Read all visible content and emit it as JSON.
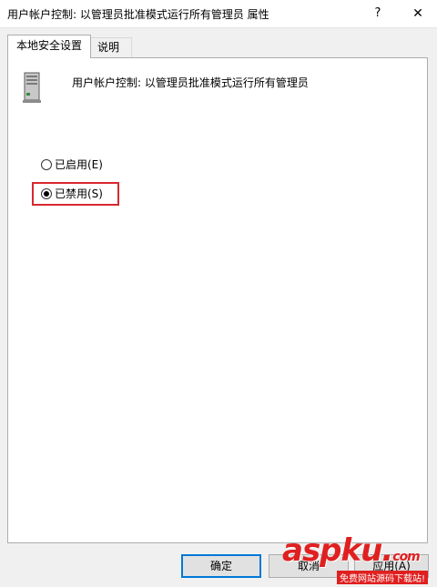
{
  "window": {
    "title": "用户帐户控制: 以管理员批准模式运行所有管理员 属性",
    "help_glyph": "?",
    "close_glyph": "✕"
  },
  "tabs": [
    {
      "label": "本地安全设置",
      "active": true
    },
    {
      "label": "说明",
      "active": false
    }
  ],
  "policy": {
    "icon": "server-icon",
    "title": "用户帐户控制: 以管理员批准模式运行所有管理员"
  },
  "options": [
    {
      "label": "已启用(E)",
      "checked": false
    },
    {
      "label": "已禁用(S)",
      "checked": true
    }
  ],
  "buttons": {
    "ok": "确定",
    "cancel": "取消",
    "apply": "应用(A)"
  },
  "watermark": {
    "brand": "aspku",
    "brand_dot": ".",
    "brand_suffix": "com",
    "tagline": "免费网站源码下载站!"
  },
  "colors": {
    "highlight": "#d9282e",
    "accent": "#0078d7",
    "watermark": "#e02020"
  }
}
